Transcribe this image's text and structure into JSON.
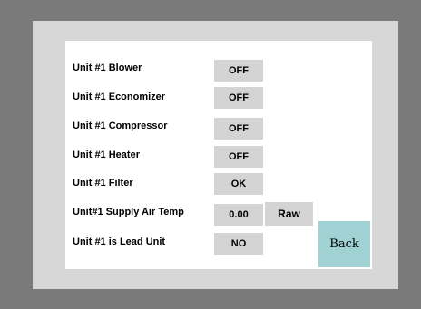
{
  "rows": [
    {
      "label": "Unit #1 Blower",
      "value": "OFF"
    },
    {
      "label": "Unit #1 Economizer",
      "value": "OFF"
    },
    {
      "label": "Unit #1 Compressor",
      "value": "OFF"
    },
    {
      "label": "Unit #1 Heater",
      "value": "OFF"
    },
    {
      "label": "Unit #1 Filter",
      "value": "OK"
    },
    {
      "label": "Unit#1 Supply Air Temp",
      "value": "0.00"
    },
    {
      "label": "Unit #1 is Lead Unit",
      "value": "NO"
    }
  ],
  "buttons": {
    "raw_label": "Raw",
    "back_label": "Back"
  },
  "colors": {
    "outer_background": "#7a7a7a",
    "bezel": "#d7d7d7",
    "panel": "#ffffff",
    "value_box": "#d4d4d4",
    "back_button": "#a0d2d4"
  }
}
